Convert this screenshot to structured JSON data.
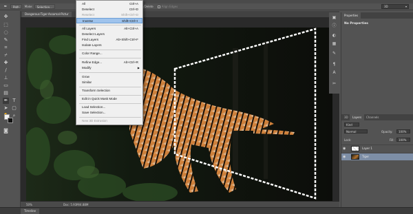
{
  "options_bar": {
    "path_label": "Path",
    "make_label": "Make:",
    "selection_label": "Selection...",
    "auto_add_delete_label": "Auto Add/Delete",
    "align_edges_label": "Align Edges",
    "workspace_value": "3D"
  },
  "document": {
    "tab_title": "Dangerous-Tiger-Assamal-Pictur",
    "zoom": "50%",
    "doc_info": "Doc: 5.93M/4.88M"
  },
  "timeline_label": "Timeline",
  "properties": {
    "tab": "Properties",
    "message": "No Properties"
  },
  "layers_panel": {
    "tabs": [
      "3D",
      "Layers",
      "Channels"
    ],
    "filter_kind": "Kind",
    "blend_mode": "Normal",
    "opacity_label": "Opacity:",
    "opacity_value": "100%",
    "lock_label": "Lock:",
    "fill_label": "Fill:",
    "fill_value": "100%",
    "layers": [
      {
        "name": "Layer 1",
        "selected": false
      },
      {
        "name": "Tiger",
        "selected": true
      }
    ]
  },
  "select_menu": {
    "items": [
      {
        "label": "All",
        "shortcut": "Ctrl+A"
      },
      {
        "label": "Deselect",
        "shortcut": "Ctrl+D"
      },
      {
        "label": "Reselect",
        "shortcut": "Shift+Ctrl+D"
      },
      {
        "label": "Inverse",
        "shortcut": "Shift+Ctrl+I"
      },
      {
        "label": "All Layers",
        "shortcut": "Alt+Ctrl+A"
      },
      {
        "label": "Deselect Layers",
        "shortcut": ""
      },
      {
        "label": "Find Layers",
        "shortcut": "Alt+Shift+Ctrl+F"
      },
      {
        "label": "Isolate Layers",
        "shortcut": ""
      },
      {
        "label": "Color Range...",
        "shortcut": ""
      },
      {
        "label": "Refine Edge...",
        "shortcut": "Alt+Ctrl+R"
      },
      {
        "label": "Modify",
        "shortcut": ""
      },
      {
        "label": "Grow",
        "shortcut": ""
      },
      {
        "label": "Similar",
        "shortcut": ""
      },
      {
        "label": "Transform Selection",
        "shortcut": ""
      },
      {
        "label": "Edit in Quick Mask Mode",
        "shortcut": ""
      },
      {
        "label": "Load Selection...",
        "shortcut": ""
      },
      {
        "label": "Save Selection...",
        "shortcut": ""
      },
      {
        "label": "New 3D Extrusion",
        "shortcut": ""
      }
    ]
  },
  "icons": {
    "pen_tool": "pen-icon",
    "eye": "eye-icon",
    "submenu": "chevron-right-icon"
  },
  "colors": {
    "menu_highlight": "#9fc3ec",
    "selected_layer": "#7d8ea6",
    "panel_bg": "#535353"
  }
}
